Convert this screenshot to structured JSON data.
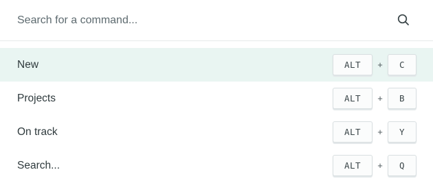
{
  "search": {
    "placeholder": "Search for a command...",
    "value": "",
    "icon": "search-icon"
  },
  "commands": [
    {
      "label": "New",
      "active": true,
      "modifier": "ALT",
      "separator": "+",
      "key": "C"
    },
    {
      "label": "Projects",
      "active": false,
      "modifier": "ALT",
      "separator": "+",
      "key": "B"
    },
    {
      "label": "On track",
      "active": false,
      "modifier": "ALT",
      "separator": "+",
      "key": "Y"
    },
    {
      "label": "Search...",
      "active": false,
      "modifier": "ALT",
      "separator": "+",
      "key": "Q"
    }
  ],
  "colors": {
    "active_row_background": "#e9f5f2",
    "text": "#2f3a3d",
    "placeholder": "#5e6b70",
    "divider": "#e6eaeb"
  }
}
